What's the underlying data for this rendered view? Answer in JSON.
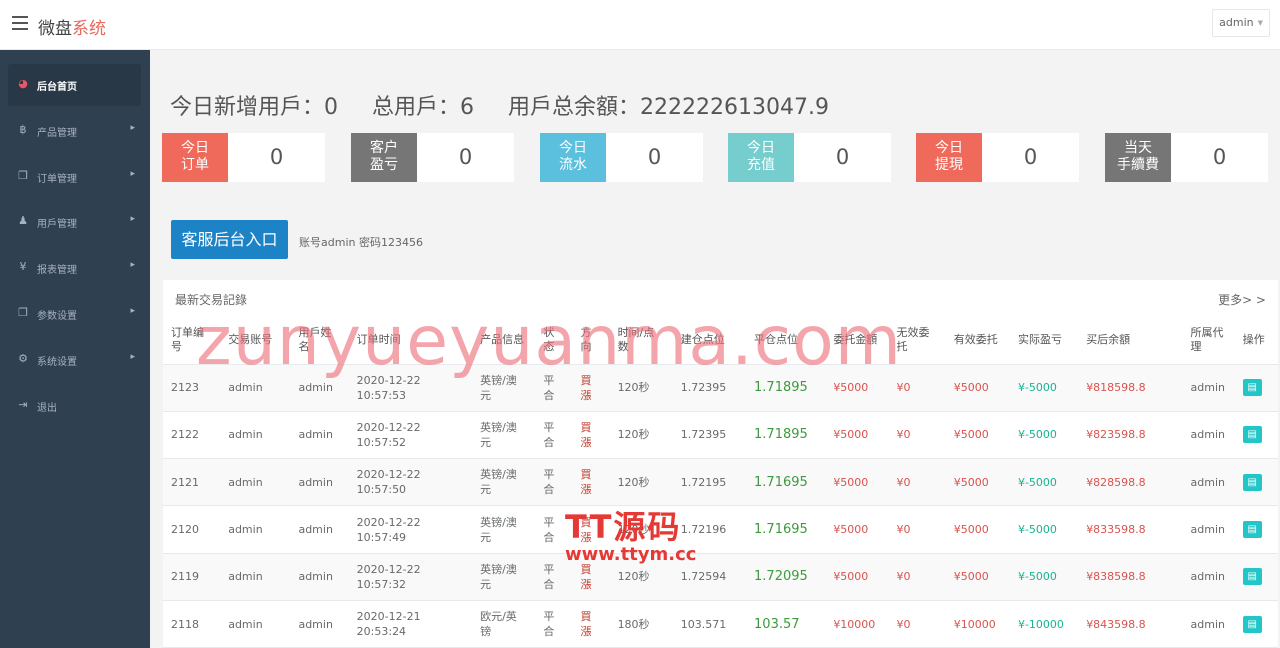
{
  "app": {
    "title_main": "微盘",
    "title_accent": "系统",
    "user": "admin"
  },
  "sidebar": {
    "items": [
      {
        "icon": "dashboard-icon",
        "label": "后台首页",
        "active": true
      },
      {
        "icon": "bitcoin-icon",
        "label": "产品管理"
      },
      {
        "icon": "copy-icon",
        "label": "订单管理"
      },
      {
        "icon": "user-icon",
        "label": "用戶管理"
      },
      {
        "icon": "yen-icon",
        "label": "报表管理"
      },
      {
        "icon": "copy-icon",
        "label": "参数设置"
      },
      {
        "icon": "gears-icon",
        "label": "系统设置"
      },
      {
        "icon": "signout-icon",
        "label": "退出"
      }
    ]
  },
  "summary": {
    "today_new_users": "今日新增用戶：0",
    "total_users": "总用戶：6",
    "total_balance": "用戶总余額：222222613047.9"
  },
  "stats": [
    {
      "label_line1": "今日",
      "label_line2": "订单",
      "value": "0",
      "color": "#f06a5c"
    },
    {
      "label_line1": "客户",
      "label_line2": "盈亏",
      "value": "0",
      "color": "#767676"
    },
    {
      "label_line1": "今日",
      "label_line2": "流水",
      "value": "0",
      "color": "#5bc0de"
    },
    {
      "label_line1": "今日",
      "label_line2": "充值",
      "value": "0",
      "color": "#76cdcd"
    },
    {
      "label_line1": "今日",
      "label_line2": "提現",
      "value": "0",
      "color": "#f06a5c"
    },
    {
      "label_line1": "当天",
      "label_line2": "手續費",
      "value": "0",
      "color": "#767676"
    }
  ],
  "service": {
    "button": "客服后台入口",
    "note": "账号admin 密码123456"
  },
  "trades": {
    "title": "最新交易記錄",
    "more": "更多> >",
    "headers": [
      "订单编号",
      "交易账号",
      "用戶姓名",
      "订单时间",
      "产品信息",
      "状态",
      "方向",
      "时间/点数",
      "建仓点位",
      "平仓点位",
      "委托金額",
      "无效委托",
      "有效委托",
      "实际盈亏",
      "买后余額",
      "所属代理",
      "操作"
    ],
    "rows": [
      [
        "2123",
        "admin",
        "admin",
        "2020-12-22 10:57:53",
        "英镑/澳元",
        "平合",
        "買漲",
        "120秒",
        "1.72395",
        "1.71895",
        "¥5000",
        "¥0",
        "¥5000",
        "¥-5000",
        "¥818598.8",
        "admin"
      ],
      [
        "2122",
        "admin",
        "admin",
        "2020-12-22 10:57:52",
        "英镑/澳元",
        "平合",
        "買漲",
        "120秒",
        "1.72395",
        "1.71895",
        "¥5000",
        "¥0",
        "¥5000",
        "¥-5000",
        "¥823598.8",
        "admin"
      ],
      [
        "2121",
        "admin",
        "admin",
        "2020-12-22 10:57:50",
        "英镑/澳元",
        "平合",
        "買漲",
        "120秒",
        "1.72195",
        "1.71695",
        "¥5000",
        "¥0",
        "¥5000",
        "¥-5000",
        "¥828598.8",
        "admin"
      ],
      [
        "2120",
        "admin",
        "admin",
        "2020-12-22 10:57:49",
        "英镑/澳元",
        "平合",
        "買漲",
        "120秒",
        "1.72196",
        "1.71695",
        "¥5000",
        "¥0",
        "¥5000",
        "¥-5000",
        "¥833598.8",
        "admin"
      ],
      [
        "2119",
        "admin",
        "admin",
        "2020-12-22 10:57:32",
        "英镑/澳元",
        "平合",
        "買漲",
        "120秒",
        "1.72594",
        "1.72095",
        "¥5000",
        "¥0",
        "¥5000",
        "¥-5000",
        "¥838598.8",
        "admin"
      ],
      [
        "2118",
        "admin",
        "admin",
        "2020-12-21 20:53:24",
        "欧元/英镑",
        "平合",
        "買漲",
        "180秒",
        "103.571",
        "103.57",
        "¥10000",
        "¥0",
        "¥10000",
        "¥-10000",
        "¥843598.8",
        "admin"
      ]
    ]
  },
  "watermarks": {
    "text": "zunyueyuanma.com",
    "logo": "TT源码",
    "logo_url": "www.ttym.cc"
  }
}
